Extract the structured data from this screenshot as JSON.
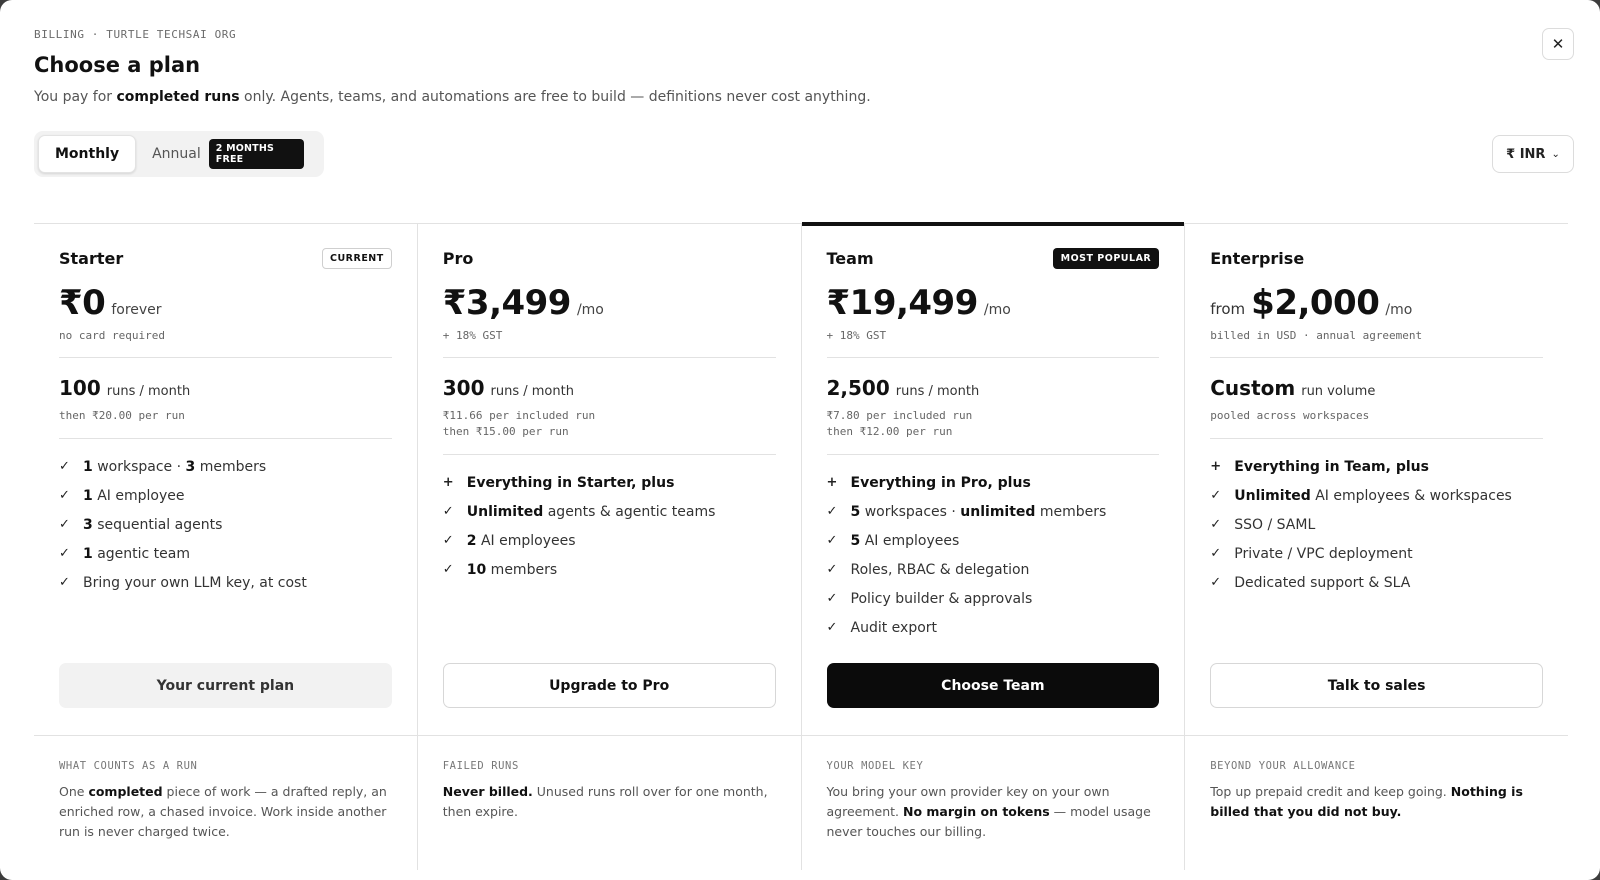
{
  "header": {
    "eyebrow": "BILLING · TURTLE TECHSAI ORG",
    "title": "Choose a plan",
    "subtitle_pre": "You pay for ",
    "subtitle_bold": "completed runs",
    "subtitle_post": " only. Agents, teams, and automations are free to build — definitions never cost anything.",
    "close_glyph": "✕"
  },
  "billing_toggle": {
    "monthly": "Monthly",
    "annual": "Annual",
    "annual_badge": "2 MONTHS FREE",
    "selected": "Monthly"
  },
  "currency": {
    "value": "₹ INR",
    "chevron": "⌄"
  },
  "plans": [
    {
      "name": "Starter",
      "tag": "CURRENT",
      "price_prefix": "",
      "price": "₹0",
      "price_unit": "forever",
      "price_note": "no card required",
      "runs": "100",
      "runs_unit": "runs / month",
      "runs_note_1": "then ₹20.00 per run",
      "runs_note_2": "",
      "features": [
        {
          "mark": "✓",
          "b1": "1",
          "t1": " workspace · ",
          "b2": "3",
          "t2": " members"
        },
        {
          "mark": "✓",
          "b1": "1",
          "t1": " AI employee",
          "b2": "",
          "t2": ""
        },
        {
          "mark": "✓",
          "b1": "3",
          "t1": " sequential agents",
          "b2": "",
          "t2": ""
        },
        {
          "mark": "✓",
          "b1": "1",
          "t1": " agentic team",
          "b2": "",
          "t2": ""
        },
        {
          "mark": "✓",
          "b1": "",
          "t1": "Bring your own LLM key, at cost",
          "b2": "",
          "t2": ""
        }
      ],
      "cta": "Your current plan"
    },
    {
      "name": "Pro",
      "tag": "",
      "price_prefix": "",
      "price": "₹3,499",
      "price_unit": "/mo",
      "price_note": "+ 18% GST",
      "runs": "300",
      "runs_unit": "runs / month",
      "runs_note_1": "₹11.66 per included run",
      "runs_note_2": "then ₹15.00 per run",
      "features": [
        {
          "mark": "+",
          "b1": "Everything in Starter, plus",
          "t1": "",
          "b2": "",
          "t2": ""
        },
        {
          "mark": "✓",
          "b1": "Unlimited",
          "t1": " agents & agentic teams",
          "b2": "",
          "t2": ""
        },
        {
          "mark": "✓",
          "b1": "2",
          "t1": " AI employees",
          "b2": "",
          "t2": ""
        },
        {
          "mark": "✓",
          "b1": "10",
          "t1": " members",
          "b2": "",
          "t2": ""
        }
      ],
      "cta": "Upgrade to Pro"
    },
    {
      "name": "Team",
      "tag": "MOST POPULAR",
      "price_prefix": "",
      "price": "₹19,499",
      "price_unit": "/mo",
      "price_note": "+ 18% GST",
      "runs": "2,500",
      "runs_unit": "runs / month",
      "runs_note_1": "₹7.80 per included run",
      "runs_note_2": "then ₹12.00 per run",
      "features": [
        {
          "mark": "+",
          "b1": "Everything in Pro, plus",
          "t1": "",
          "b2": "",
          "t2": ""
        },
        {
          "mark": "✓",
          "b1": "5",
          "t1": " workspaces · ",
          "b2": "unlimited",
          "t2": " members"
        },
        {
          "mark": "✓",
          "b1": "5",
          "t1": " AI employees",
          "b2": "",
          "t2": ""
        },
        {
          "mark": "✓",
          "b1": "",
          "t1": "Roles, RBAC & delegation",
          "b2": "",
          "t2": ""
        },
        {
          "mark": "✓",
          "b1": "",
          "t1": "Policy builder & approvals",
          "b2": "",
          "t2": ""
        },
        {
          "mark": "✓",
          "b1": "",
          "t1": "Audit export",
          "b2": "",
          "t2": ""
        }
      ],
      "cta": "Choose Team"
    },
    {
      "name": "Enterprise",
      "tag": "",
      "price_prefix": "from",
      "price": "$2,000",
      "price_unit": "/mo",
      "price_note": "billed in USD · annual agreement",
      "runs": "Custom",
      "runs_unit": "run volume",
      "runs_note_1": "pooled across workspaces",
      "runs_note_2": "",
      "features": [
        {
          "mark": "+",
          "b1": "Everything in Team, plus",
          "t1": "",
          "b2": "",
          "t2": ""
        },
        {
          "mark": "✓",
          "b1": "Unlimited",
          "t1": " AI employees & workspaces",
          "b2": "",
          "t2": ""
        },
        {
          "mark": "✓",
          "b1": "",
          "t1": "SSO / SAML",
          "b2": "",
          "t2": ""
        },
        {
          "mark": "✓",
          "b1": "",
          "t1": "Private / VPC deployment",
          "b2": "",
          "t2": ""
        },
        {
          "mark": "✓",
          "b1": "",
          "t1": "Dedicated support & SLA",
          "b2": "",
          "t2": ""
        }
      ],
      "cta": "Talk to sales"
    }
  ],
  "footer": [
    {
      "title": "WHAT COUNTS AS A RUN",
      "pre": "One ",
      "bold": "completed",
      "post": " piece of work — a drafted reply, an enriched row, a chased invoice. Work inside another run is never charged twice.",
      "bold2": "",
      "post2": ""
    },
    {
      "title": "FAILED RUNS",
      "pre": "",
      "bold": "Never billed.",
      "post": " Unused runs roll over for one month, then expire.",
      "bold2": "",
      "post2": ""
    },
    {
      "title": "YOUR MODEL KEY",
      "pre": "You bring your own provider key on your own agreement. ",
      "bold": "No margin on tokens",
      "post": " — model usage never touches our billing.",
      "bold2": "",
      "post2": ""
    },
    {
      "title": "BEYOND YOUR ALLOWANCE",
      "pre": "Top up prepaid credit and keep going. ",
      "bold": "Nothing is billed that you did not buy.",
      "post": "",
      "bold2": "",
      "post2": ""
    }
  ]
}
